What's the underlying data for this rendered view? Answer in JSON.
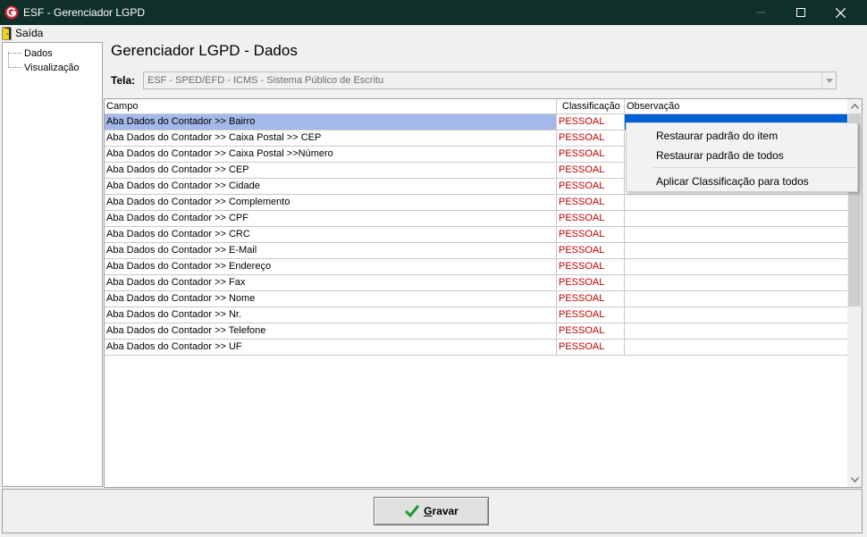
{
  "window": {
    "title": "ESF - Gerenciador LGPD",
    "controls": {
      "minimize": "minimize-icon",
      "maximize": "maximize-icon",
      "close": "close-icon"
    }
  },
  "menu": {
    "exit_label": "Saída"
  },
  "tree": {
    "items": [
      {
        "label": "Dados"
      },
      {
        "label": "Visualização"
      }
    ]
  },
  "main": {
    "page_title": "Gerenciador LGPD - Dados",
    "screen_label": "Tela:",
    "screen_value": "ESF - SPED/EFD - ICMS - Sistema Público de Escritu"
  },
  "grid": {
    "columns": [
      "Campo",
      "Classificação",
      "Observação"
    ],
    "rows": [
      {
        "campo": "Aba Dados do Contador >> Bairro",
        "classificacao": "PESSOAL",
        "observacao": ""
      },
      {
        "campo": "Aba Dados do Contador >> Caixa Postal >> CEP",
        "classificacao": "PESSOAL",
        "observacao": ""
      },
      {
        "campo": "Aba Dados do Contador >> Caixa Postal >>Número",
        "classificacao": "PESSOAL",
        "observacao": ""
      },
      {
        "campo": "Aba Dados do Contador >> CEP",
        "classificacao": "PESSOAL",
        "observacao": ""
      },
      {
        "campo": "Aba Dados do Contador >> Cidade",
        "classificacao": "PESSOAL",
        "observacao": ""
      },
      {
        "campo": "Aba Dados do Contador >> Complemento",
        "classificacao": "PESSOAL",
        "observacao": ""
      },
      {
        "campo": "Aba Dados do Contador >> CPF",
        "classificacao": "PESSOAL",
        "observacao": ""
      },
      {
        "campo": "Aba Dados do Contador >> CRC",
        "classificacao": "PESSOAL",
        "observacao": ""
      },
      {
        "campo": "Aba Dados do Contador >> E-Mail",
        "classificacao": "PESSOAL",
        "observacao": ""
      },
      {
        "campo": "Aba Dados do Contador >> Endereço",
        "classificacao": "PESSOAL",
        "observacao": ""
      },
      {
        "campo": "Aba Dados do Contador >> Fax",
        "classificacao": "PESSOAL",
        "observacao": ""
      },
      {
        "campo": "Aba Dados do Contador >> Nome",
        "classificacao": "PESSOAL",
        "observacao": ""
      },
      {
        "campo": "Aba Dados do Contador >> Nr.",
        "classificacao": "PESSOAL",
        "observacao": ""
      },
      {
        "campo": "Aba Dados do Contador >> Telefone",
        "classificacao": "PESSOAL",
        "observacao": ""
      },
      {
        "campo": "Aba Dados do Contador >> UF",
        "classificacao": "PESSOAL",
        "observacao": ""
      }
    ]
  },
  "context_menu": {
    "items": [
      {
        "label": "Restaurar padrão do item"
      },
      {
        "label": "Restaurar padrão de todos"
      },
      {
        "label": "Aplicar Classificação para todos"
      }
    ]
  },
  "footer": {
    "save_label": "Gravar"
  },
  "colors": {
    "titlebar": "#0f2f2b",
    "selection_row": "#a4b8ea",
    "selection_cell": "#0060d8",
    "classification_text": "#c00000"
  }
}
